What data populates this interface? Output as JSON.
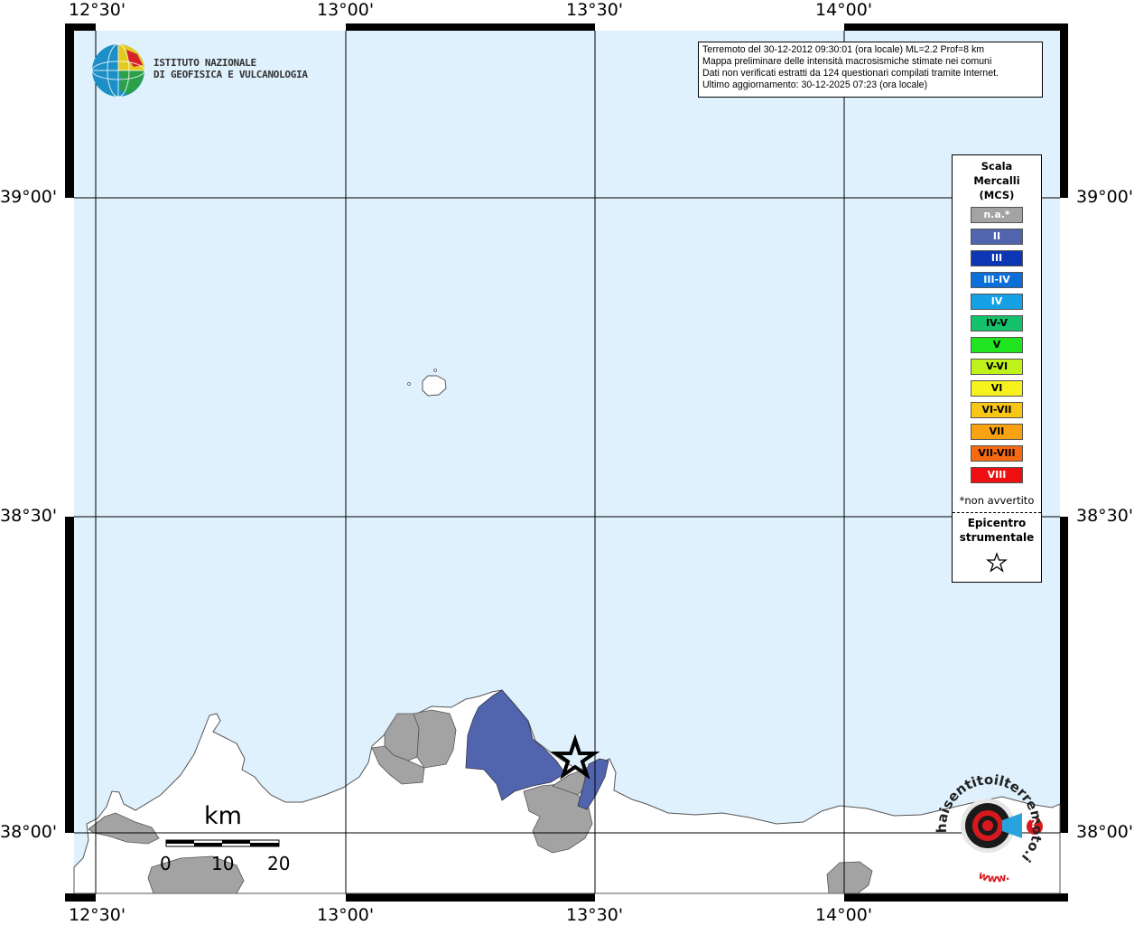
{
  "map": {
    "sea_color": "#dff1fd",
    "land_color": "#ffffff",
    "na_color": "#a3a3a3",
    "intensity_ii_color": "#5065ae",
    "coast_color": "#555555",
    "lon_labels": [
      "12°30'",
      "13°00'",
      "13°30'",
      "14°00'"
    ],
    "lat_labels": [
      "39°00'",
      "38°30'",
      "38°00'"
    ]
  },
  "info": {
    "line1": "Terremoto del 30-12-2012 09:30:01 (ora locale) ML=2.2 Prof=8 km",
    "line2": "Mappa preliminare delle intensità macrosismiche stimate nei comuni",
    "line3": "Dati non verificati estratti da 124 questionari compilati tramite Internet.",
    "line4": "Ultimo aggiornamento: 30-12-2025 07:23 (ora locale)"
  },
  "ingv": {
    "line1": "ISTITUTO NAZIONALE",
    "line2": "DI GEOFISICA E VULCANOLOGIA"
  },
  "legend": {
    "title1": "Scala",
    "title2": "Mercalli",
    "title3": "(MCS)",
    "items": [
      {
        "label": "n.a.*",
        "color": "#a3a3a3",
        "text_color": "#ffffff"
      },
      {
        "label": "II",
        "color": "#5065ae",
        "text_color": "#ffffff"
      },
      {
        "label": "III",
        "color": "#0d36b5",
        "text_color": "#ffffff"
      },
      {
        "label": "III-IV",
        "color": "#0a6fd8",
        "text_color": "#ffffff"
      },
      {
        "label": "IV",
        "color": "#16a0e6",
        "text_color": "#ffffff"
      },
      {
        "label": "IV-V",
        "color": "#13c26a",
        "text_color": "#000000"
      },
      {
        "label": "V",
        "color": "#1fe41f",
        "text_color": "#000000"
      },
      {
        "label": "V-VI",
        "color": "#bff21a",
        "text_color": "#000000"
      },
      {
        "label": "VI",
        "color": "#f7f21c",
        "text_color": "#000000"
      },
      {
        "label": "VI-VII",
        "color": "#f8c614",
        "text_color": "#000000"
      },
      {
        "label": "VII",
        "color": "#f9a312",
        "text_color": "#000000"
      },
      {
        "label": "VII-VIII",
        "color": "#f76a12",
        "text_color": "#000000"
      },
      {
        "label": "VIII",
        "color": "#ee1010",
        "text_color": "#ffffff"
      }
    ],
    "note": "*non avvertito",
    "epicentre1": "Epicentro",
    "epicentre2": "strumentale"
  },
  "scale_bar": {
    "unit": "km",
    "ticks": [
      "0",
      "10",
      "20"
    ]
  },
  "badge": {
    "text": "haisentitoilterremoto.it",
    "www": "www.",
    "q": "?"
  }
}
